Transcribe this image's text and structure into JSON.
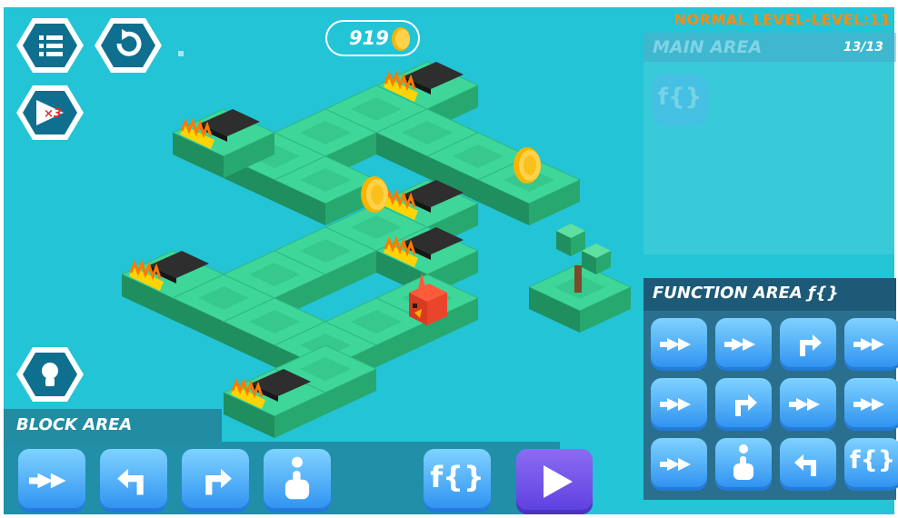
{
  "level_title": "NORMAL LEVEL-LEVEL:11",
  "coins": "919",
  "speed_label": "×3",
  "main_area": {
    "title": "MAIN AREA",
    "count": "13/13",
    "slot_label": "f{}"
  },
  "function_area": {
    "title": "FUNCTION AREA ƒ{}",
    "tiles": [
      {
        "type": "forward",
        "icon": "double-chevron-right-icon"
      },
      {
        "type": "forward",
        "icon": "double-chevron-right-icon"
      },
      {
        "type": "turn-right",
        "icon": "turn-right-arrow-icon"
      },
      {
        "type": "forward",
        "icon": "double-chevron-right-icon"
      },
      {
        "type": "forward",
        "icon": "double-chevron-right-icon"
      },
      {
        "type": "turn-right",
        "icon": "turn-right-arrow-icon"
      },
      {
        "type": "forward",
        "icon": "double-chevron-right-icon"
      },
      {
        "type": "forward",
        "icon": "double-chevron-right-icon"
      },
      {
        "type": "forward",
        "icon": "double-chevron-right-icon"
      },
      {
        "type": "action",
        "icon": "hand-tap-icon"
      },
      {
        "type": "turn-left",
        "icon": "turn-left-arrow-icon"
      },
      {
        "type": "function",
        "icon": "function-icon",
        "label": "f{}"
      }
    ]
  },
  "block_area": {
    "title": "BLOCK AREA",
    "function_label": "f{}",
    "tiles": [
      {
        "type": "forward",
        "icon": "double-chevron-right-icon"
      },
      {
        "type": "turn-left",
        "icon": "turn-left-arrow-icon"
      },
      {
        "type": "turn-right",
        "icon": "turn-right-arrow-icon"
      },
      {
        "type": "action",
        "icon": "hand-tap-icon"
      }
    ]
  },
  "colors": {
    "background": "#23c4d6",
    "tile_top": "#3fd69a",
    "level_title": "#ff8a0d",
    "block": "#2b8ff0",
    "play": "#6a4ce8"
  }
}
